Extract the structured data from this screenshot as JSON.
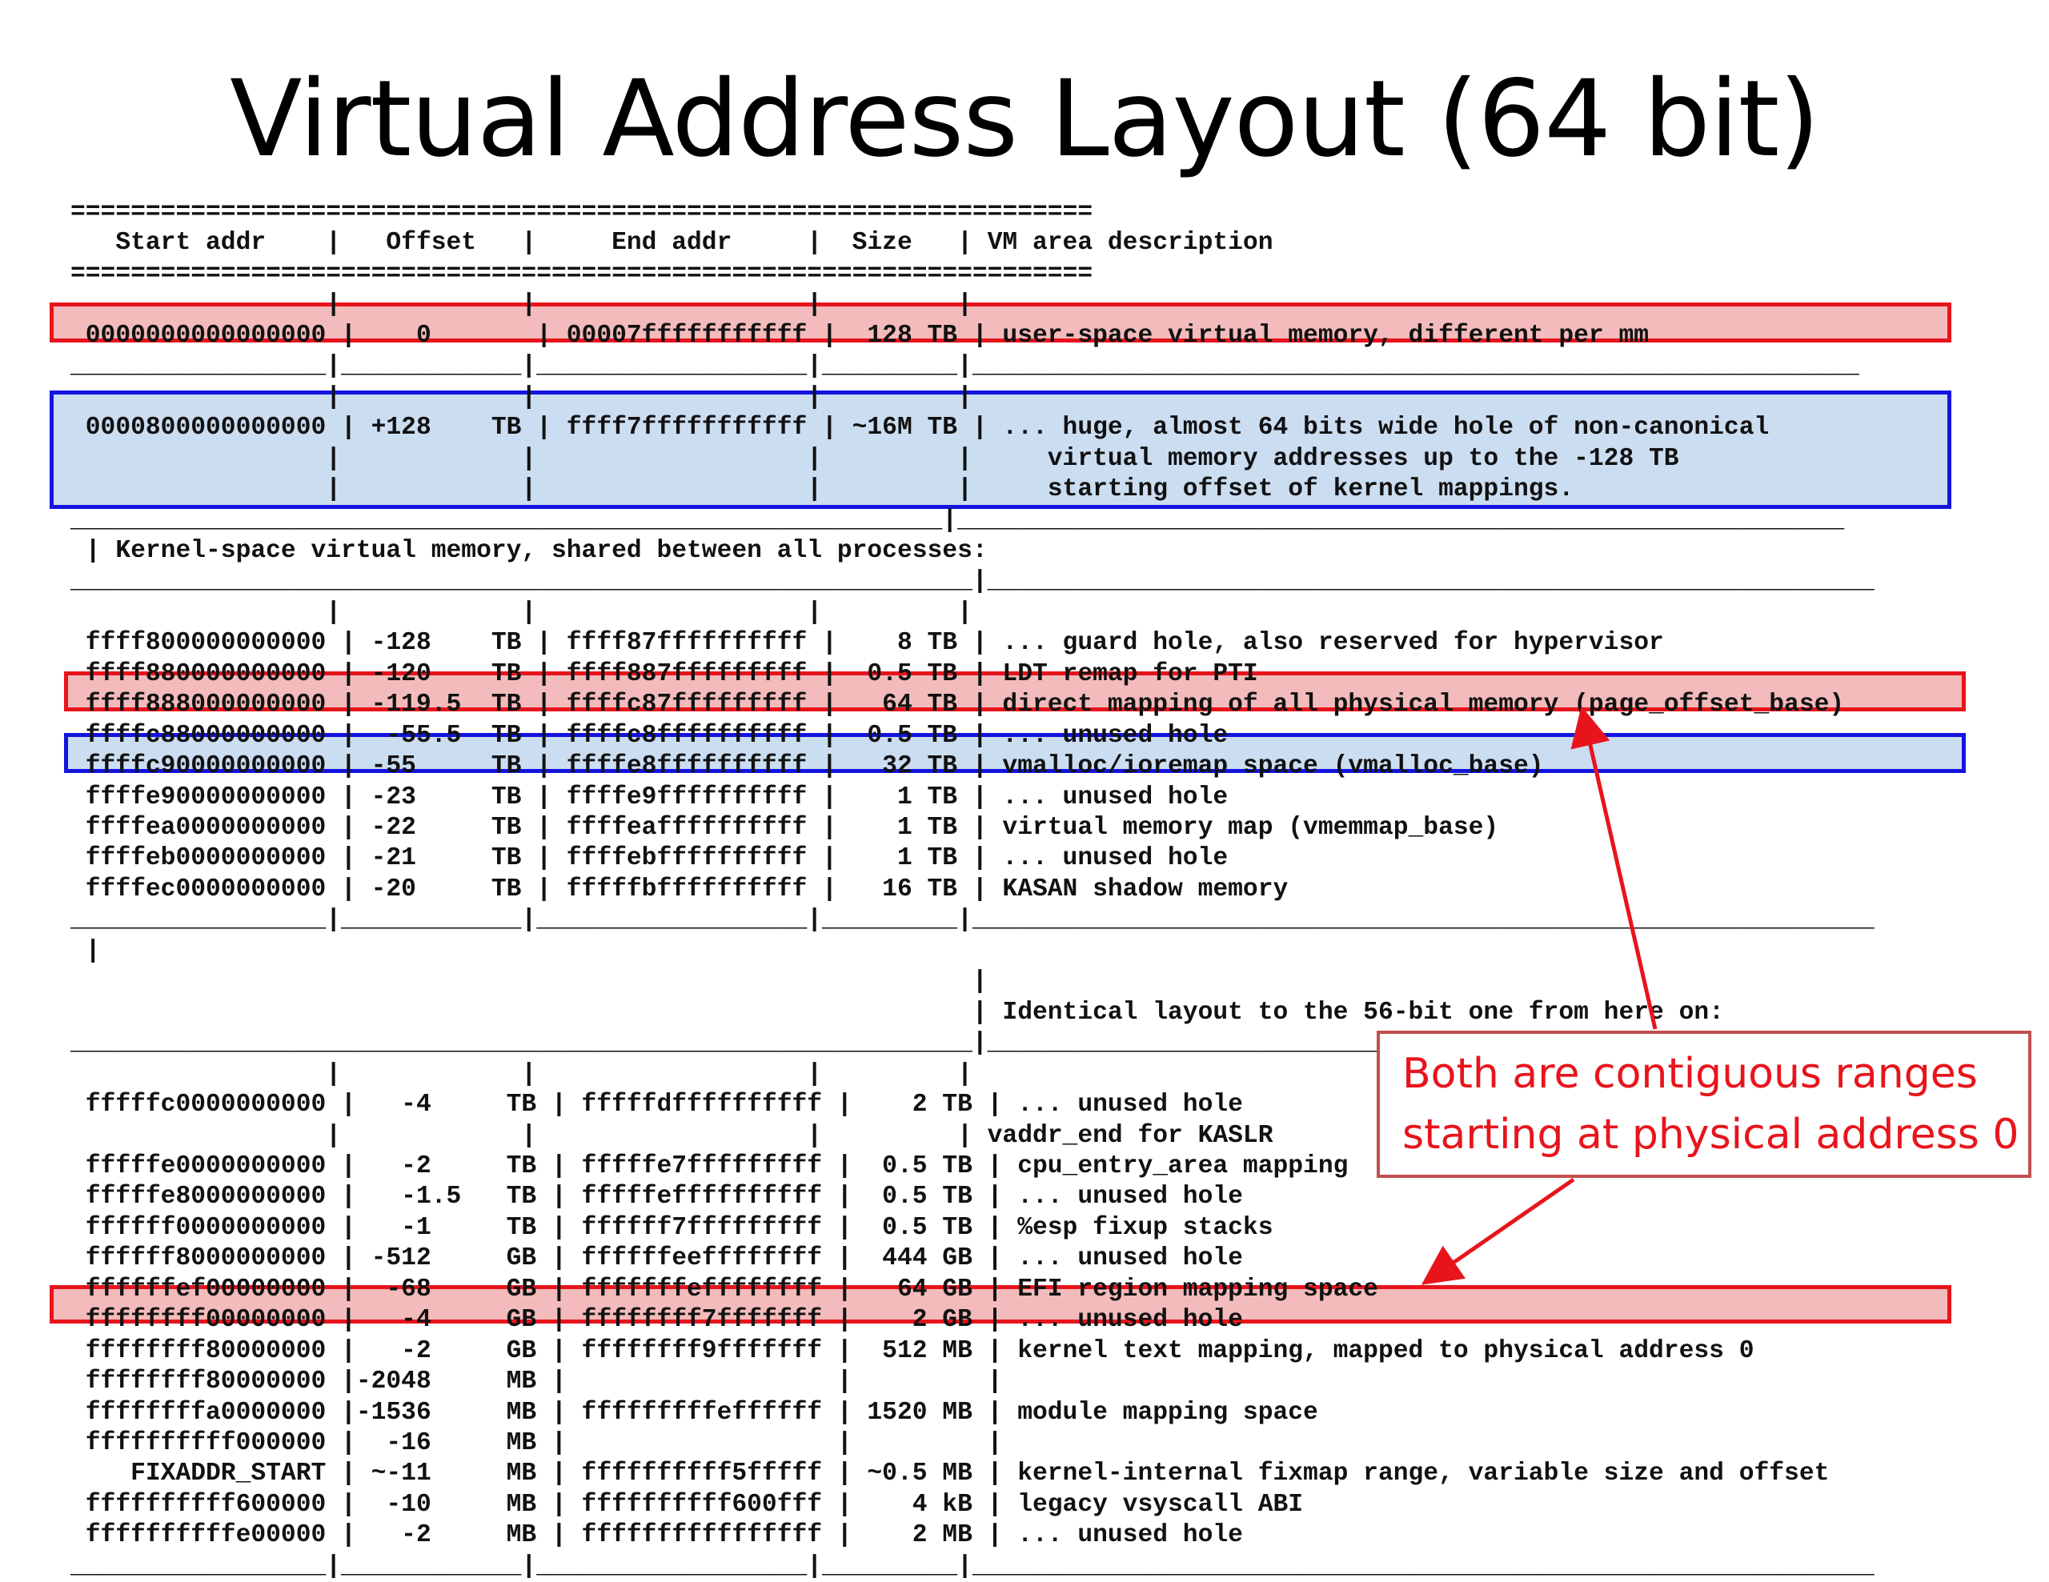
{
  "title": "Virtual Address Layout (64 bit)",
  "callout": {
    "line1": "Both are contiguous ranges",
    "line2": "starting at physical address 0"
  },
  "colors": {
    "highlight_red": "#e8141c",
    "highlight_blue": "#1414e0",
    "callout_text": "#e8141c",
    "callout_border": "#c0504d"
  },
  "table_lines": [
    "====================================================================",
    "   Start addr    |   Offset   |     End addr     |  Size   | VM area description",
    "====================================================================",
    "                 |            |                  |         |",
    " 0000000000000000 |    0       | 00007fffffffffff |  128 TB | user-space virtual memory, different per mm",
    "_________________|____________|__________________|_________|___________________________________________________________",
    "                 |            |                  |         |",
    " 0000800000000000 | +128    TB | ffff7fffffffffff | ~16M TB | ... huge, almost 64 bits wide hole of non-canonical",
    "                 |            |                  |         |     virtual memory addresses up to the -128 TB",
    "                 |            |                  |         |     starting offset of kernel mappings.",
    "__________________________________________________________|___________________________________________________________",
    " | Kernel-space virtual memory, shared between all processes:",
    "____________________________________________________________|___________________________________________________________",
    "                 |            |                  |         |",
    " ffff800000000000 | -128    TB | ffff87ffffffffff |    8 TB | ... guard hole, also reserved for hypervisor",
    " ffff880000000000 | -120    TB | ffff887fffffffff |  0.5 TB | LDT remap for PTI",
    " ffff888000000000 | -119.5  TB | ffffc87fffffffff |   64 TB | direct mapping of all physical memory (page_offset_base)",
    " ffffc88000000000 |  -55.5  TB | ffffc8ffffffffff |  0.5 TB | ... unused hole",
    " ffffc90000000000 | -55     TB | ffffe8ffffffffff |   32 TB | vmalloc/ioremap space (vmalloc_base)",
    " ffffe90000000000 | -23     TB | ffffe9ffffffffff |    1 TB | ... unused hole",
    " ffffea0000000000 | -22     TB | ffffeaffffffffff |    1 TB | virtual memory map (vmemmap_base)",
    " ffffeb0000000000 | -21     TB | ffffebffffffffff |    1 TB | ... unused hole",
    " ffffec0000000000 | -20     TB | fffffbffffffffff |   16 TB | KASAN shadow memory",
    "_________________|____________|__________________|_________|____________________________________________________________",
    " |",
    "                                                            |",
    "                                                            | Identical layout to the 56-bit one from here on:",
    "____________________________________________________________|____________________________________________________________",
    "                 |            |                  |         |",
    " fffffc0000000000 |   -4     TB | fffffdffffffffff |    2 TB | ... unused hole",
    "                 |            |                  |         | vaddr_end for KASLR",
    " fffffe0000000000 |   -2     TB | fffffe7fffffffff |  0.5 TB | cpu_entry_area mapping",
    " fffffe8000000000 |   -1.5   TB | fffffeffffffffff |  0.5 TB | ... unused hole",
    " ffffff0000000000 |   -1     TB | ffffff7fffffffff |  0.5 TB | %esp fixup stacks",
    " ffffff8000000000 | -512     GB | ffffffeeffffffff |  444 GB | ... unused hole",
    " ffffffef00000000 |  -68     GB | fffffffeffffffff |   64 GB | EFI region mapping space",
    " ffffffff00000000 |   -4     GB | ffffffff7fffffff |    2 GB | ... unused hole",
    " ffffffff80000000 |   -2     GB | ffffffff9fffffff |  512 MB | kernel text mapping, mapped to physical address 0",
    " ffffffff80000000 |-2048     MB |                  |         |",
    " ffffffffa0000000 |-1536     MB | fffffffffeffffff | 1520 MB | module mapping space",
    " ffffffffff000000 |  -16     MB |                  |         |",
    "    FIXADDR_START | ~-11     MB | ffffffffff5fffff | ~0.5 MB | kernel-internal fixmap range, variable size and offset",
    " ffffffffff600000 |  -10     MB | ffffffffff600fff |    4 kB | legacy vsyscall ABI",
    " ffffffffffe00000 |   -2     MB | ffffffffffffffff |    2 MB | ... unused hole",
    "_________________|____________|__________________|_________|____________________________________________________________"
  ]
}
